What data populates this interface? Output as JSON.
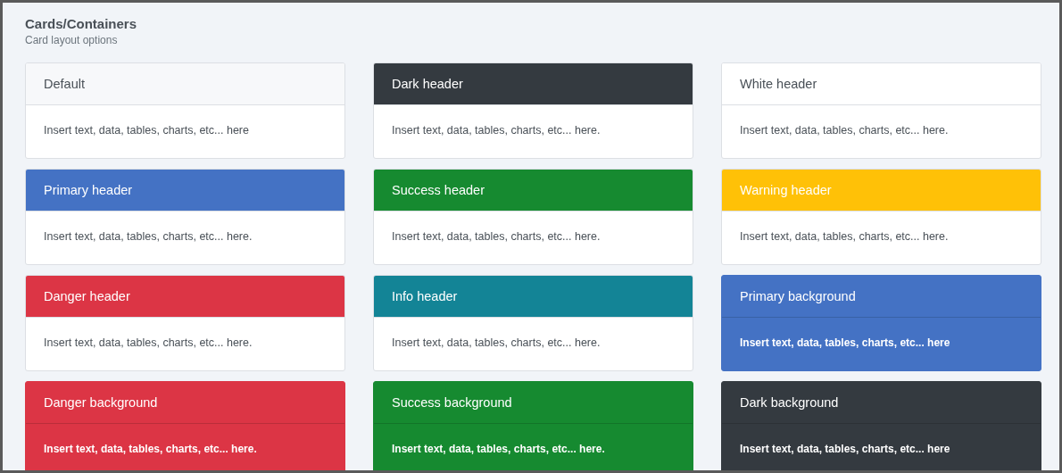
{
  "page": {
    "title": "Cards/Containers",
    "subtitle": "Card layout options"
  },
  "cards": [
    {
      "header": "Default",
      "body": "Insert text, data, tables, charts, etc... here",
      "color": "#f7f8fa",
      "kind": "light-header"
    },
    {
      "header": "Dark header",
      "body": "Insert text, data, tables, charts, etc... here.",
      "color": "#343a40",
      "kind": "header"
    },
    {
      "header": "White header",
      "body": "Insert text, data, tables, charts, etc... here.",
      "color": "#ffffff",
      "kind": "light-header"
    },
    {
      "header": "Primary header",
      "body": "Insert text, data, tables, charts, etc... here.",
      "color": "#4472c4",
      "kind": "header"
    },
    {
      "header": "Success header",
      "body": "Insert text, data, tables, charts, etc... here.",
      "color": "#168a30",
      "kind": "header"
    },
    {
      "header": "Warning header",
      "body": "Insert text, data, tables, charts, etc... here.",
      "color": "#ffc107",
      "kind": "header"
    },
    {
      "header": "Danger header",
      "body": "Insert text, data, tables, charts, etc... here.",
      "color": "#dc3545",
      "kind": "header"
    },
    {
      "header": "Info header",
      "body": "Insert text, data, tables, charts, etc... here.",
      "color": "#138496",
      "kind": "header"
    },
    {
      "header": "Primary background",
      "body": "Insert text, data, tables, charts, etc... here",
      "color": "#4472c4",
      "kind": "background"
    },
    {
      "header": "Danger background",
      "body": "Insert text, data, tables, charts, etc... here.",
      "color": "#dc3545",
      "kind": "background"
    },
    {
      "header": "Success background",
      "body": "Insert text, data, tables, charts, etc... here.",
      "color": "#168a30",
      "kind": "background"
    },
    {
      "header": "Dark background",
      "body": "Insert text, data, tables, charts, etc... here",
      "color": "#343a40",
      "kind": "background"
    }
  ]
}
